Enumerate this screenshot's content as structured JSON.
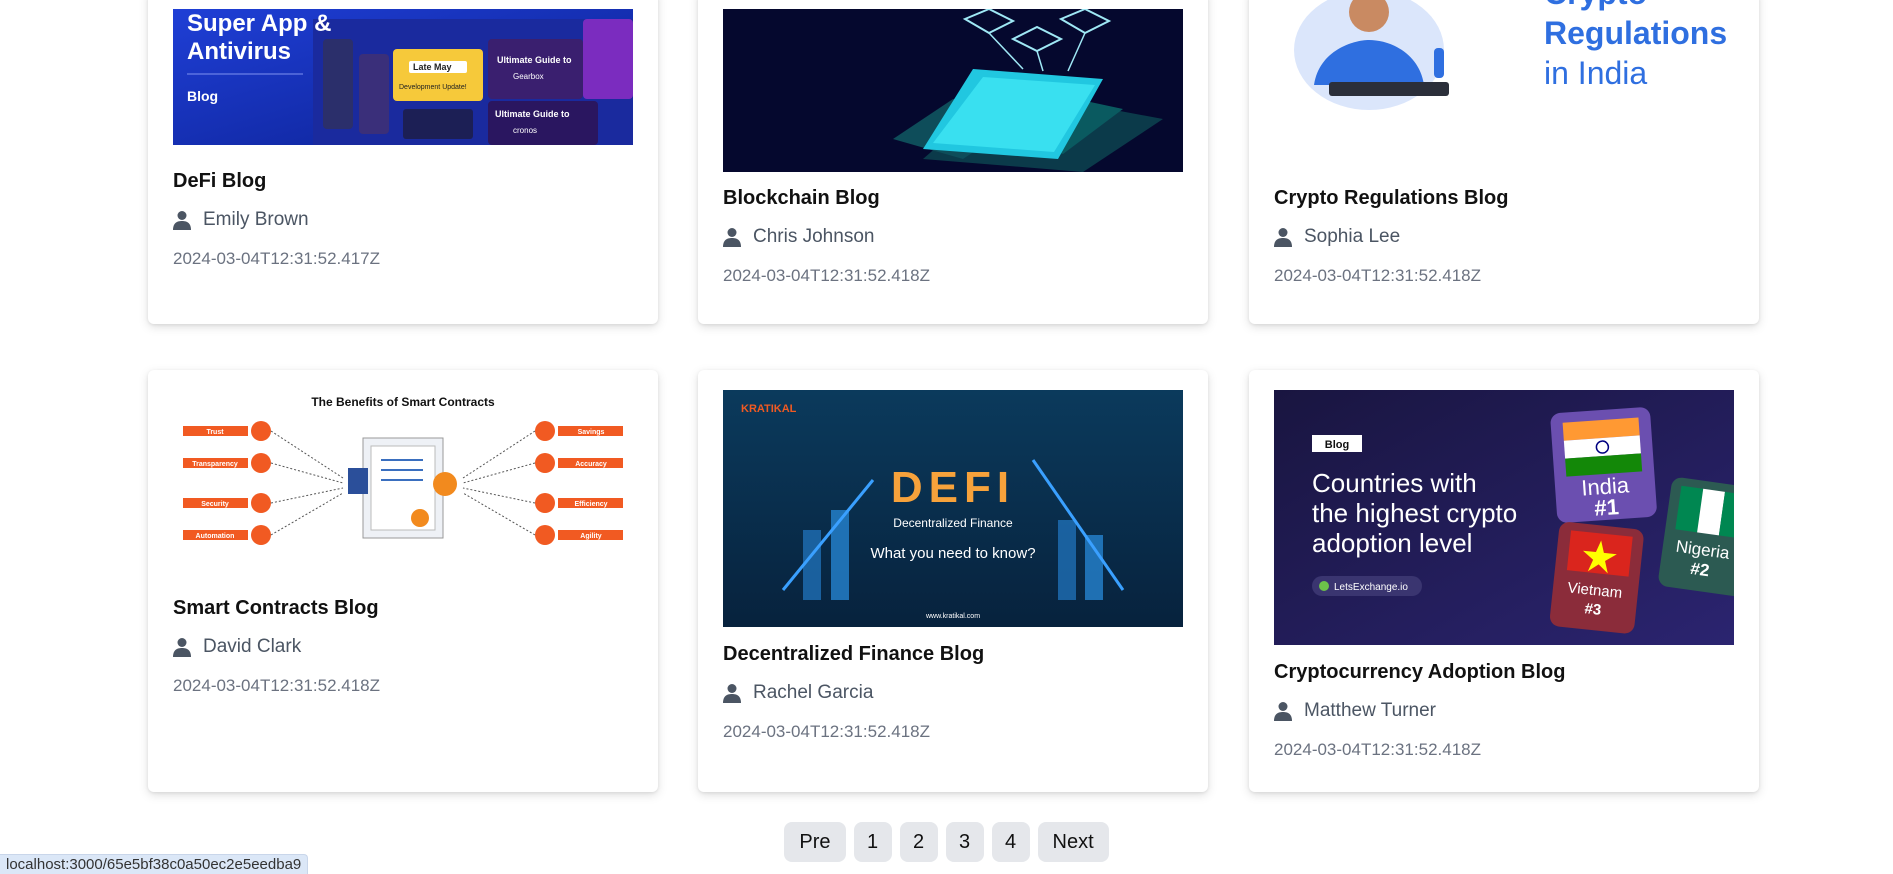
{
  "cards": [
    {
      "title": "DeFi Blog",
      "author": "Emily Brown",
      "date": "2024-03-04T12:31:52.417Z",
      "image": {
        "line1": "Super App &",
        "line2": "Antivirus",
        "tag": "Blog",
        "box1": "Late May",
        "box1b": "Development Update!",
        "guide1": "Ultimate Guide to",
        "guide1b": "Gearbox",
        "guide2": "Ultimate Guide to",
        "guide2b": "cronos"
      }
    },
    {
      "title": "Blockchain Blog",
      "author": "Chris Johnson",
      "date": "2024-03-04T12:31:52.418Z",
      "image": {}
    },
    {
      "title": "Crypto Regulations Blog",
      "author": "Sophia Lee",
      "date": "2024-03-04T12:31:52.418Z",
      "image": {
        "line1": "Crypto",
        "line2": "Regulations",
        "line3": "in India"
      }
    },
    {
      "title": "Smart Contracts Blog",
      "author": "David Clark",
      "date": "2024-03-04T12:31:52.418Z",
      "image": {
        "heading": "The Benefits of Smart Contracts",
        "left": [
          "Trust",
          "Transparency",
          "Security",
          "Automation"
        ],
        "right": [
          "Savings",
          "Accuracy",
          "Efficiency",
          "Agility"
        ]
      }
    },
    {
      "title": "Decentralized Finance Blog",
      "author": "Rachel Garcia",
      "date": "2024-03-04T12:31:52.418Z",
      "image": {
        "brand": "KRATIKAL",
        "big": "DEFI",
        "sub": "Decentralized Finance",
        "question": "What you need to know?",
        "url": "www.kratikal.com"
      }
    },
    {
      "title": "Cryptocurrency Adoption Blog",
      "author": "Matthew Turner",
      "date": "2024-03-04T12:31:52.418Z",
      "image": {
        "tag": "Blog",
        "line1": "Countries with",
        "line2": "the highest crypto",
        "line3": "adoption level",
        "brand": "LetsExchange.io",
        "c1": "India",
        "r1": "#1",
        "c2": "Nigeria",
        "r2": "#2",
        "c3": "Vietnam",
        "r3": "#3"
      }
    }
  ],
  "pagination": {
    "prev": "Pre",
    "pages": [
      "1",
      "2",
      "3",
      "4"
    ],
    "next": "Next"
  },
  "status_bar": {
    "url": "localhost:3000/65e5bf38c0a50ec2e5eedba9"
  },
  "colors": {
    "pager_bg": "#e5e7eb",
    "card_bg": "#ffffff",
    "title": "#111111",
    "meta": "#6b7280"
  }
}
